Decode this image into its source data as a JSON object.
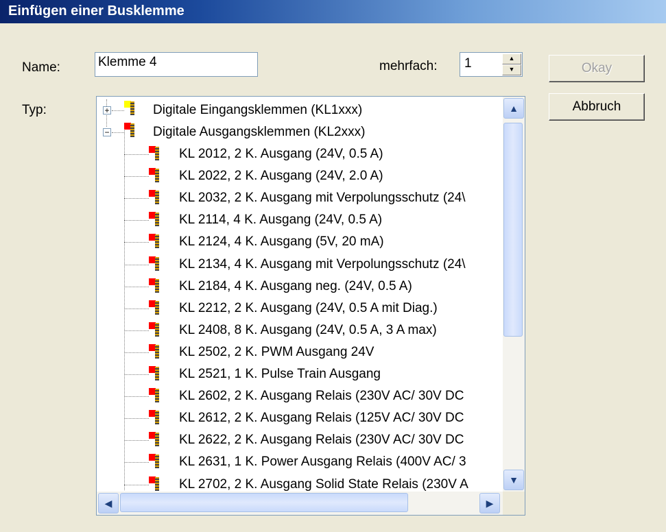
{
  "dialog": {
    "title": "Einfügen einer Busklemme",
    "name_label": "Name:",
    "name_value": "Klemme 4",
    "mehrfach_label": "mehrfach:",
    "mehrfach_value": "1",
    "typ_label": "Typ:",
    "okay_label": "Okay",
    "okay_enabled": false,
    "abbruch_label": "Abbruch"
  },
  "tree": {
    "groups": [
      {
        "label": "Digitale Eingangsklemmen (KL1xxx)",
        "expanded": false,
        "color": "#ffff00"
      },
      {
        "label": "Digitale Ausgangsklemmen (KL2xxx)",
        "expanded": true,
        "color": "#ff0000"
      }
    ],
    "items": [
      "KL 2012, 2 K. Ausgang (24V, 0.5 A)",
      "KL 2022, 2 K. Ausgang (24V, 2.0 A)",
      "KL 2032, 2 K. Ausgang mit Verpolungsschutz (24\\",
      "KL 2114, 4 K. Ausgang (24V, 0.5 A)",
      "KL 2124, 4 K. Ausgang (5V, 20 mA)",
      "KL 2134, 4 K. Ausgang mit Verpolungsschutz (24\\",
      "KL 2184, 4 K. Ausgang neg. (24V, 0.5 A)",
      "KL 2212, 2 K. Ausgang (24V, 0.5 A mit Diag.)",
      "KL 2408, 8 K. Ausgang (24V, 0.5 A, 3 A max)",
      "KL 2502, 2 K. PWM Ausgang 24V",
      "KL 2521, 1 K. Pulse Train Ausgang",
      "KL 2602, 2 K. Ausgang Relais (230V AC/ 30V DC",
      "KL 2612, 2 K. Ausgang Relais (125V AC/ 30V DC",
      "KL 2622, 2 K. Ausgang Relais (230V AC/ 30V DC",
      "KL 2631, 1 K. Power Ausgang Relais (400V AC/ 3",
      "KL 2702, 2 K. Ausgang Solid State Relais (230V A"
    ],
    "item_color": "#ff0000"
  }
}
